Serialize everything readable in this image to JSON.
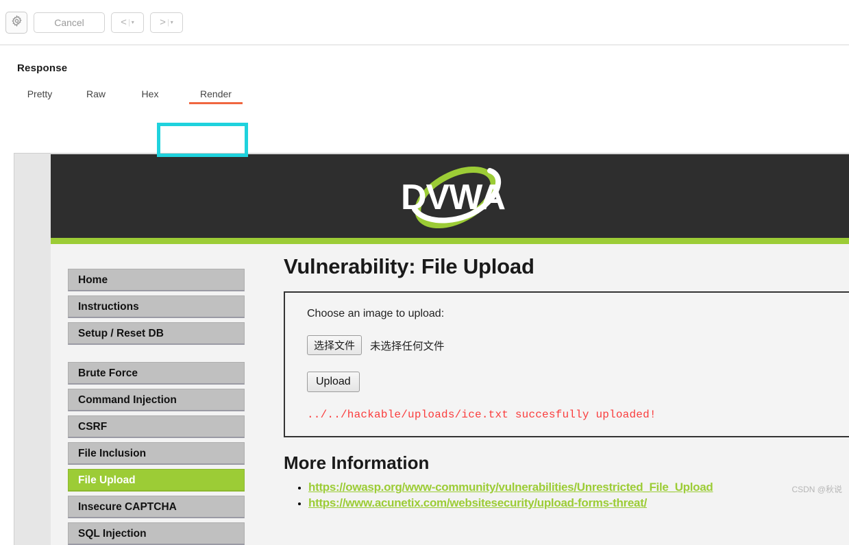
{
  "toolbar": {
    "gear_icon": "gear-icon",
    "cancel_label": "Cancel",
    "back_arrow": "<",
    "back_caret": "▾",
    "forward_arrow": ">",
    "forward_caret": "▾",
    "separator": "|"
  },
  "response": {
    "title": "Response",
    "tabs": [
      {
        "label": "Pretty",
        "active": false
      },
      {
        "label": "Raw",
        "active": false
      },
      {
        "label": "Hex",
        "active": false
      },
      {
        "label": "Render",
        "active": true
      }
    ],
    "highlight_color": "#1fd2dd",
    "active_tab_underline_color": "#f0663f"
  },
  "dvwa": {
    "logo_text": "DVWA",
    "header_bg": "#2e2e2e",
    "accent_green": "#9ccc36",
    "sidebar": [
      {
        "label": "Home",
        "active": false
      },
      {
        "label": "Instructions",
        "active": false
      },
      {
        "label": "Setup / Reset DB",
        "active": false
      },
      {
        "label": "Brute Force",
        "active": false
      },
      {
        "label": "Command Injection",
        "active": false
      },
      {
        "label": "CSRF",
        "active": false
      },
      {
        "label": "File Inclusion",
        "active": false
      },
      {
        "label": "File Upload",
        "active": true
      },
      {
        "label": "Insecure CAPTCHA",
        "active": false
      },
      {
        "label": "SQL Injection",
        "active": false
      }
    ],
    "main": {
      "heading": "Vulnerability: File Upload",
      "choose_label": "Choose an image to upload:",
      "file_button_label": "选择文件",
      "file_status": "未选择任何文件",
      "upload_button_label": "Upload",
      "success_message": "../../hackable/uploads/ice.txt succesfully uploaded!",
      "success_color": "#fa3c3c",
      "more_info_heading": "More Information",
      "links": [
        "https://owasp.org/www-community/vulnerabilities/Unrestricted_File_Upload",
        "https://www.acunetix.com/websitesecurity/upload-forms-threat/"
      ]
    }
  },
  "watermark": "CSDN @秋说"
}
